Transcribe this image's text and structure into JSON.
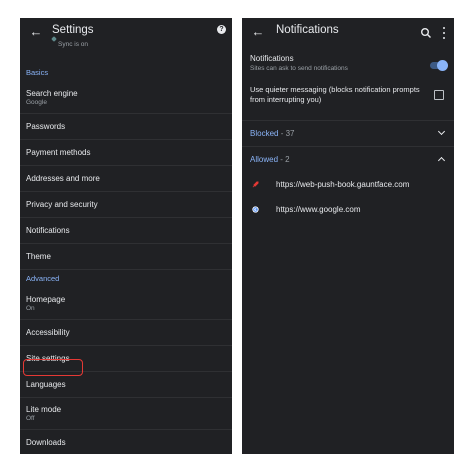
{
  "settings": {
    "title": "Settings",
    "subtitle": "Sync is on",
    "help_icon": "?",
    "sections": {
      "basics": "Basics",
      "advanced": "Advanced"
    },
    "items": [
      {
        "label": "Search engine",
        "sub": "Google"
      },
      {
        "label": "Passwords"
      },
      {
        "label": "Payment methods"
      },
      {
        "label": "Addresses and more"
      },
      {
        "label": "Privacy and security"
      },
      {
        "label": "Notifications"
      },
      {
        "label": "Theme"
      },
      {
        "label": "Homepage",
        "sub": "On"
      },
      {
        "label": "Accessibility"
      },
      {
        "label": "Site settings"
      },
      {
        "label": "Languages"
      },
      {
        "label": "Lite mode",
        "sub": "Off"
      },
      {
        "label": "Downloads"
      }
    ]
  },
  "notifications": {
    "title": "Notifications",
    "toggle_row": {
      "label": "Notifications",
      "sub": "Sites can ask to send notifications",
      "enabled": true
    },
    "quiet": {
      "label": "Use quieter messaging (blocks notification prompts from interrupting you)",
      "checked": false
    },
    "blocked": {
      "name": "Blocked",
      "count": " - 37",
      "expanded": false
    },
    "allowed": {
      "name": "Allowed",
      "count": " - 2",
      "expanded": true
    },
    "sites": [
      {
        "url": "https://web-push-book.gauntface.com",
        "icon": "rocket-icon"
      },
      {
        "url": "https://www.google.com",
        "icon": "google-icon"
      }
    ]
  },
  "colors": {
    "background": "#202124",
    "accent": "#8ab4f8",
    "highlight": "#e53935"
  }
}
